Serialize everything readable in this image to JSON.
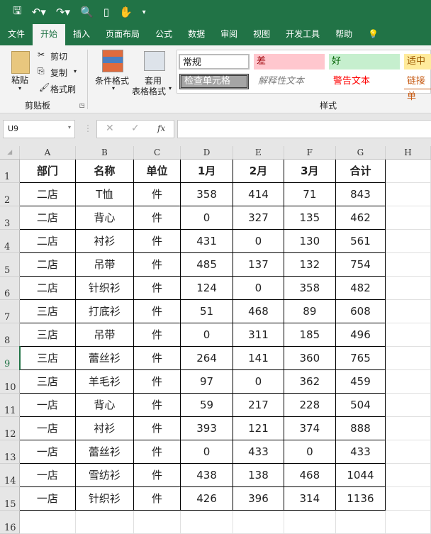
{
  "qat": {
    "icons": [
      "save-icon",
      "undo-icon",
      "redo-icon",
      "print-preview-icon",
      "new-icon",
      "touch-mode-icon",
      "customize-icon"
    ]
  },
  "tabs": [
    "文件",
    "开始",
    "插入",
    "页面布局",
    "公式",
    "数据",
    "审阅",
    "视图",
    "开发工具",
    "帮助"
  ],
  "ribbon": {
    "paste": "粘贴",
    "cut": "剪切",
    "copy": "复制",
    "format_painter": "格式刷",
    "clipboard_group": "剪贴板",
    "cond_format": "条件格式",
    "table_format_1": "套用",
    "table_format_2": "表格格式",
    "styles_group": "样式",
    "styles": {
      "normal": "常规",
      "bad": "差",
      "good": "好",
      "neutral": "适中",
      "check_cell": "检查单元格",
      "explanatory": "解释性文本",
      "warning": "警告文本",
      "hyperlink": "链接单"
    }
  },
  "formula_bar": {
    "name_box": "U9",
    "fx": "fx",
    "value": ""
  },
  "columns": [
    "A",
    "B",
    "C",
    "D",
    "E",
    "F",
    "G",
    "H"
  ],
  "headers": [
    "部门",
    "名称",
    "单位",
    "1月",
    "2月",
    "3月",
    "合计"
  ],
  "rows": [
    [
      "二店",
      "T恤",
      "件",
      "358",
      "414",
      "71",
      "843"
    ],
    [
      "二店",
      "背心",
      "件",
      "0",
      "327",
      "135",
      "462"
    ],
    [
      "二店",
      "衬衫",
      "件",
      "431",
      "0",
      "130",
      "561"
    ],
    [
      "二店",
      "吊带",
      "件",
      "485",
      "137",
      "132",
      "754"
    ],
    [
      "二店",
      "针织衫",
      "件",
      "124",
      "0",
      "358",
      "482"
    ],
    [
      "三店",
      "打底衫",
      "件",
      "51",
      "468",
      "89",
      "608"
    ],
    [
      "三店",
      "吊带",
      "件",
      "0",
      "311",
      "185",
      "496"
    ],
    [
      "三店",
      "蕾丝衫",
      "件",
      "264",
      "141",
      "360",
      "765"
    ],
    [
      "三店",
      "羊毛衫",
      "件",
      "97",
      "0",
      "362",
      "459"
    ],
    [
      "一店",
      "背心",
      "件",
      "59",
      "217",
      "228",
      "504"
    ],
    [
      "一店",
      "衬衫",
      "件",
      "393",
      "121",
      "374",
      "888"
    ],
    [
      "一店",
      "蕾丝衫",
      "件",
      "0",
      "433",
      "0",
      "433"
    ],
    [
      "一店",
      "雪纺衫",
      "件",
      "438",
      "138",
      "468",
      "1044"
    ],
    [
      "一店",
      "针织衫",
      "件",
      "426",
      "396",
      "314",
      "1136"
    ]
  ]
}
